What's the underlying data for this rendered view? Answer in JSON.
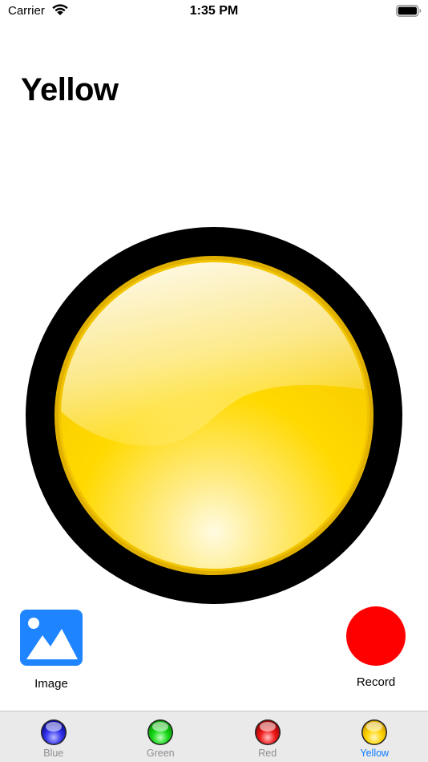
{
  "status_bar": {
    "carrier": "Carrier",
    "time": "1:35 PM"
  },
  "page": {
    "title": "Yellow"
  },
  "light": {
    "color": "yellow",
    "fill": "#ffd700",
    "rim": "#e0b200",
    "border": "#000000"
  },
  "actions": {
    "image": {
      "label": "Image",
      "icon": "photo-icon",
      "color": "#1f84ff"
    },
    "record": {
      "label": "Record",
      "icon": "record-icon",
      "color": "#ff0000"
    }
  },
  "tabs": [
    {
      "label": "Blue",
      "icon": "blue-orb-icon",
      "color": "#2a2ae8",
      "active": false
    },
    {
      "label": "Green",
      "icon": "green-orb-icon",
      "color": "#11d011",
      "active": false
    },
    {
      "label": "Red",
      "icon": "red-orb-icon",
      "color": "#e81010",
      "active": false
    },
    {
      "label": "Yellow",
      "icon": "yellow-orb-icon",
      "color": "#f5cc00",
      "active": true
    }
  ],
  "colors": {
    "accent": "#0a7aff",
    "tab_inactive": "#8e8e93"
  }
}
